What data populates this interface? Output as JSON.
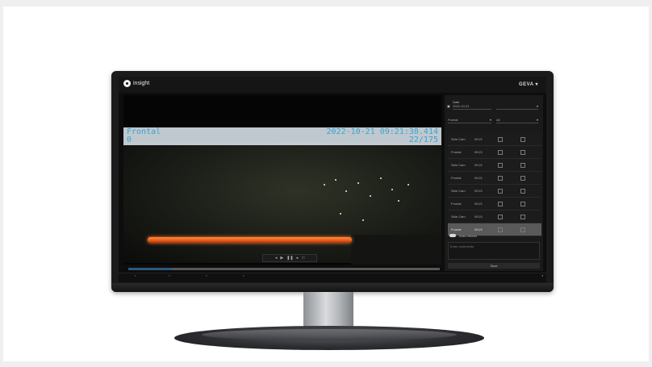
{
  "app": {
    "logo_text": "insight",
    "brand_text": "GEVA"
  },
  "video": {
    "camera_label": "Frontal",
    "camera_index": "0",
    "timestamp": "2022-10-21 09:21:38.414",
    "frame_counter": "22/175",
    "playback_progress": 0.14
  },
  "sidebar": {
    "date_label": "Date",
    "date_value": "2022-10-21",
    "filter_1_value": "Frontal",
    "filter_2_value": "All",
    "rows": [
      {
        "camera": "Side Cam",
        "time": "09:21"
      },
      {
        "camera": "Frontal",
        "time": "09:21"
      },
      {
        "camera": "Side Cam",
        "time": "09:21"
      },
      {
        "camera": "Frontal",
        "time": "09:21"
      },
      {
        "camera": "Side Cam",
        "time": "09:21"
      },
      {
        "camera": "Frontal",
        "time": "09:21"
      },
      {
        "camera": "Side Cam",
        "time": "09:21"
      },
      {
        "camera": "Frontal",
        "time": "09:21"
      }
    ],
    "selected_row_index": 7,
    "toggle_label": "Auto refresh",
    "notes_placeholder": "Enter comments",
    "apply_label": "Save"
  },
  "colors": {
    "overlay_text": "#3aa3cf",
    "hot_bar": "#e8591a"
  }
}
